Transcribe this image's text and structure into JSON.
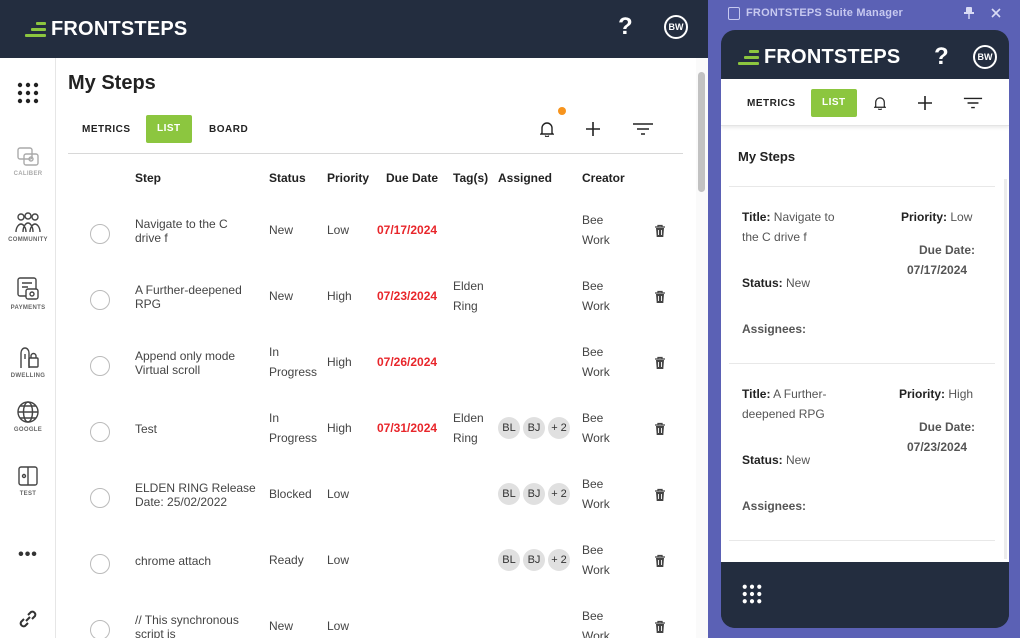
{
  "brand": "FRONTSTEPS",
  "user_initials": "BW",
  "help_label": "?",
  "sidebar": {
    "items": [
      {
        "label": "CALIBER",
        "icon": "caliber-icon"
      },
      {
        "label": "COMMUNITY",
        "icon": "community-icon"
      },
      {
        "label": "PAYMENTS",
        "icon": "payments-icon"
      },
      {
        "label": "DWELLING",
        "icon": "dwelling-icon"
      },
      {
        "label": "GOOGLE",
        "icon": "globe-icon"
      },
      {
        "label": "TEST",
        "icon": "test-icon"
      }
    ],
    "more": "•••"
  },
  "main": {
    "title": "My Steps",
    "tabs": [
      "METRICS",
      "LIST",
      "BOARD"
    ],
    "active_tab": "LIST",
    "columns": [
      "Step",
      "Status",
      "Priority",
      "Due Date",
      "Tag(s)",
      "Assigned",
      "Creator"
    ],
    "rows": [
      {
        "step": [
          "Navigate to the C",
          "drive f"
        ],
        "status": [
          "New"
        ],
        "priority": "Low",
        "due": "07/17/2024",
        "tags": [],
        "assigned": [],
        "creator": [
          "Bee",
          "Work"
        ]
      },
      {
        "step": [
          "A Further-deepened",
          "RPG"
        ],
        "status": [
          "New"
        ],
        "priority": "High",
        "due": "07/23/2024",
        "tags": [
          "Elden",
          "Ring"
        ],
        "assigned": [],
        "creator": [
          "Bee",
          "Work"
        ]
      },
      {
        "step": [
          "Append only mode",
          "Virtual scroll"
        ],
        "status": [
          "In",
          "Progress"
        ],
        "priority": "High",
        "due": "07/26/2024",
        "tags": [],
        "assigned": [],
        "creator": [
          "Bee",
          "Work"
        ]
      },
      {
        "step": [
          "Test"
        ],
        "status": [
          "In",
          "Progress"
        ],
        "priority": "High",
        "due": "07/31/2024",
        "tags": [
          "Elden",
          "Ring"
        ],
        "assigned": [
          "BL",
          "BJ",
          "+ 2"
        ],
        "creator": [
          "Bee",
          "Work"
        ]
      },
      {
        "step": [
          "ELDEN RING Release",
          "Date: 25/02/2022"
        ],
        "status": [
          "Blocked"
        ],
        "priority": "Low",
        "due": "",
        "tags": [],
        "assigned": [
          "BL",
          "BJ",
          "+ 2"
        ],
        "creator": [
          "Bee",
          "Work"
        ]
      },
      {
        "step": [
          "chrome attach"
        ],
        "status": [
          "Ready"
        ],
        "priority": "Low",
        "due": "",
        "tags": [],
        "assigned": [
          "BL",
          "BJ",
          "+ 2"
        ],
        "creator": [
          "Bee",
          "Work"
        ]
      },
      {
        "step": [
          "// This synchronous",
          "script is"
        ],
        "status": [
          "New"
        ],
        "priority": "Low",
        "due": "",
        "tags": [],
        "assigned": [],
        "creator": [
          "Bee",
          "Work"
        ]
      }
    ]
  },
  "extension": {
    "window_title": "FRONTSTEPS Suite Manager",
    "tabs": [
      "METRICS",
      "LIST"
    ],
    "active_tab": "LIST",
    "section_title": "My Steps",
    "labels": {
      "title": "Title:",
      "priority": "Priority:",
      "due": "Due Date:",
      "status": "Status:",
      "assignees": "Assignees:"
    },
    "cards": [
      {
        "title": [
          "Navigate to",
          "the C drive f"
        ],
        "priority": "Low",
        "due": "07/17/2024",
        "status": "New"
      },
      {
        "title": [
          "A Further-",
          "deepened RPG"
        ],
        "priority": "High",
        "due": "07/23/2024",
        "status": "New"
      }
    ]
  },
  "colors": {
    "accent": "#8CC63F",
    "navy": "#232D3F",
    "due": "#E8262B",
    "frame": "#5B61B5",
    "notification": "#F7941D"
  }
}
